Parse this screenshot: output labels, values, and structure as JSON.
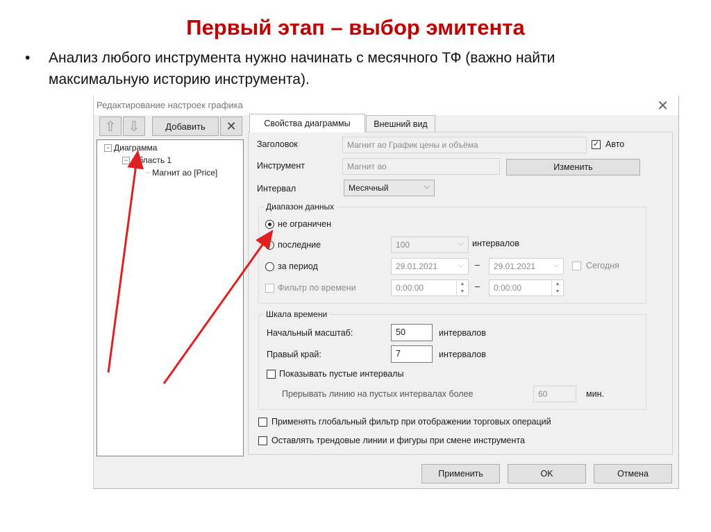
{
  "slide": {
    "title": "Первый этап – выбор эмитента",
    "bullet": "•",
    "bullet_text": "Анализ любого инструмента нужно начинать с месячного ТФ (важно найти максимальную историю инструмента)."
  },
  "dialog": {
    "title": "Редактирование настроек графика",
    "close": "✕",
    "toolbar": {
      "up_icon": "⇧",
      "down_icon": "⇩",
      "add_label": "Добавить",
      "delete_icon": "✕"
    },
    "tree": {
      "root": "Диаграмма",
      "area": "Область 1",
      "leaf": "Магнит ао [Price]",
      "collapse_glyph": "−"
    },
    "tabs": {
      "props": "Свойства диаграммы",
      "appearance": "Внешний вид"
    },
    "form": {
      "title_label": "Заголовок",
      "title_value": "Магнит ао График цены и объёма",
      "auto_label": "Авто",
      "auto_check": "✓",
      "instrument_label": "Инструмент",
      "instrument_value": "Магнит ао",
      "change_button": "Изменить",
      "interval_label": "Интервал",
      "interval_value": "Месячный",
      "chevron": "⌵"
    },
    "range": {
      "group_title": "Диапазон данных",
      "unlimited": "не ограничен",
      "last": "последние",
      "last_value": "100",
      "intervals": "интервалов",
      "period": "за период",
      "date_from": "29.01.2021",
      "dash": "–",
      "date_to": "29.01.2021",
      "today": "Сегодня",
      "time_filter": "Фильтр по времени",
      "time_from": "0:00:00",
      "time_to": "0:00:00",
      "spin_up": "▲",
      "spin_down": "▼"
    },
    "timescale": {
      "group_title": "Шкала времени",
      "initial_scale_label": "Начальный масштаб:",
      "initial_scale_value": "50",
      "initial_scale_unit": "интервалов",
      "right_edge_label": "Правый край:",
      "right_edge_value": "7",
      "right_edge_unit": "интервалов",
      "show_empty": "Показывать пустые интервалы",
      "break_line": "Прерывать линию на пустых интервалах более",
      "break_value": "60",
      "break_unit": "мин."
    },
    "options": {
      "global_filter": "Применять глобальный фильтр при отображении торговых операций",
      "keep_trend": "Оставлять трендовые линии и фигуры при смене инструмента"
    },
    "buttons": {
      "apply": "Применить",
      "ok": "OK",
      "cancel": "Отмена"
    }
  },
  "colors": {
    "title_red": "#c00000",
    "arrow_red": "#e02020"
  }
}
